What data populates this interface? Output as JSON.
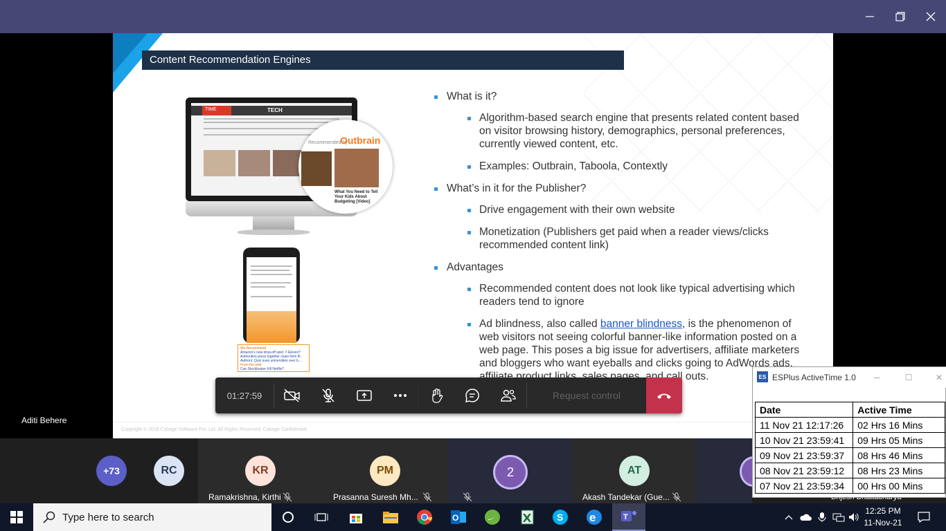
{
  "window": {
    "minimize_icon": "minimize-icon",
    "maximize_icon": "maximize-icon",
    "close_icon": "close-icon"
  },
  "slide": {
    "title": "Content Recommendation Engines",
    "bullets": [
      {
        "level": 1,
        "text": "What is it?"
      },
      {
        "level": 2,
        "text": "Algorithm-based search engine that presents related content based on visitor browsing history, demographics, personal preferences, currently viewed content, etc."
      },
      {
        "level": 2,
        "text": "Examples: Outbrain, Taboola, Contextly"
      },
      {
        "level": 1,
        "text": "What’s in it for the Publisher?"
      },
      {
        "level": 2,
        "text": "Drive engagement with their own website"
      },
      {
        "level": 2,
        "text": "Monetization (Publishers get paid when a reader views/clicks recommended content link)"
      },
      {
        "level": 1,
        "text": "Advantages"
      },
      {
        "level": 2,
        "text": "Recommended content does not look like typical advertising which readers tend to ignore"
      }
    ],
    "last_bullet": {
      "prefix": "Ad blindness, also called ",
      "link": "banner blindness",
      "suffix": ", is the phenomenon of web visitors not seeing colorful banner-like information posted on a web page. This poses a big issue for advertisers, affiliate marketers and bloggers who want eyeballs and clicks going to AdWords ads, affiliate product links, sales pages, and call outs."
    },
    "copyright": "Copyright © 2018 Cybage Software Pvt. Ltd. All Rights Reserved. Cybage Confidential",
    "illustration": {
      "time_label": "TIME",
      "tech_label": "TECH",
      "recommended_by": "Recommended by",
      "outbrain": "Outbrain",
      "caption": "What You Need to Tell Your Kids About Budgeting [Video]",
      "phone_rec_title": "We Recommend",
      "phone_rec_items": [
        "Amazon's new drop-off spot: 7-Eleven?",
        "Authorities press together clues from fli..",
        "Authors: Quiz sues universities over b..."
      ],
      "phone_from_web": "From the web",
      "phone_web_item": "Can Stockbuster Kill Netflix?"
    }
  },
  "toolbar": {
    "time": "01:27:59",
    "request_control": "Request control",
    "buttons": [
      "camera-off-icon",
      "mic-off-icon",
      "share-tray-icon",
      "more-icon",
      "raise-hand-icon",
      "chat-icon",
      "participants-icon"
    ],
    "hangup_icon": "hang-up-icon"
  },
  "presenter_name": "Aditi Behere",
  "participants": {
    "overflow": "+73",
    "rc": "RC",
    "tiles": [
      {
        "initials": "KR",
        "name": "Ramakrishna, Kirthi",
        "color": "#fde3d9",
        "text": "#8a3a22"
      },
      {
        "initials": "PM",
        "name": "Prasanna Suresh Mh...",
        "color": "#fde8c2",
        "text": "#7a4a00"
      },
      {
        "initials": "2",
        "name": "",
        "color": "#7b5ab0",
        "text": "#ffffff"
      },
      {
        "initials": "AT",
        "name": "Akash Tandekar (Gue...",
        "color": "#d3eee1",
        "text": "#1f6b4a"
      }
    ],
    "hidden_name": "Brijesh Bhattacharya"
  },
  "esplus": {
    "title": "ESPlus ActiveTime 1.0",
    "columns": [
      "Date",
      "Active Time"
    ],
    "rows": [
      [
        "11 Nov 21 12:17:26",
        "02 Hrs  16 Mins"
      ],
      [
        "10 Nov 21 23:59:41",
        "09 Hrs  05 Mins"
      ],
      [
        "09 Nov 21 23:59:37",
        "08 Hrs  46 Mins"
      ],
      [
        "08 Nov 21 23:59:12",
        "08 Hrs  23 Mins"
      ],
      [
        "07 Nov 21 23:59:34",
        "00 Hrs  00 Mins"
      ]
    ]
  },
  "taskbar": {
    "search_placeholder": "Type here to search",
    "time": "12:25 PM",
    "date": "11-Nov-21",
    "apps": [
      "cortana-icon",
      "task-view-icon",
      "store-icon",
      "file-explorer-icon",
      "chrome-icon",
      "outlook-icon",
      "spring-icon",
      "excel-icon",
      "skype-icon",
      "edge-icon",
      "teams-icon"
    ]
  }
}
